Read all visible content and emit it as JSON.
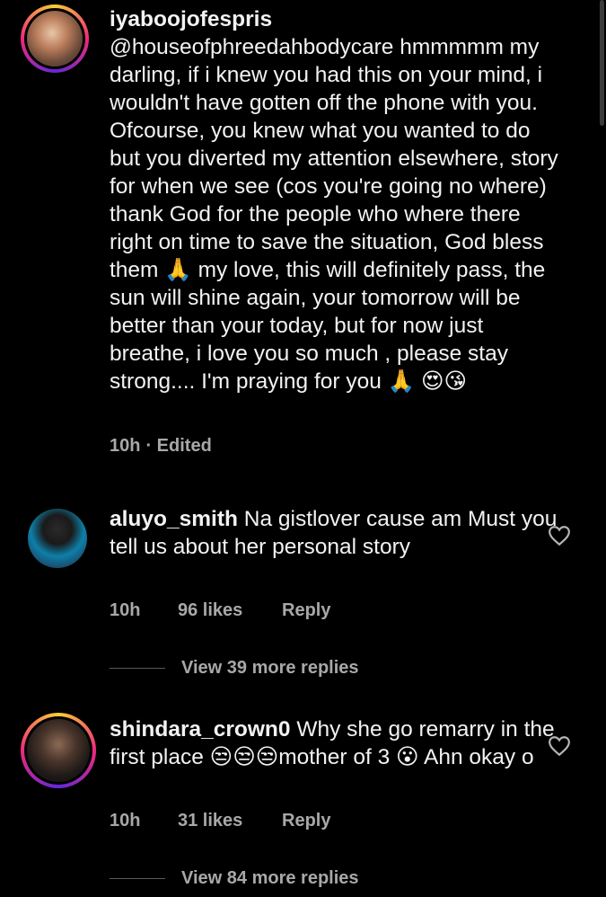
{
  "comments": [
    {
      "username": "iyaboojofespris",
      "text": "@houseofphreedahbodycare hmmmmm my darling, if i knew you had this on your mind, i wouldn't have gotten off the phone with you. Ofcourse, you knew what you wanted to do but you diverted my attention elsewhere, story for when we see (cos you're going no where) thank God for the people who where there right on time to save the situation, God bless them 🙏 my love, this will definitely pass, the sun will shine again, your tomorrow will be better than your today, but for now just breathe, i love you so much , please stay strong.... I'm praying for you 🙏 😍😘",
      "time": "10h",
      "edited": "· Edited",
      "avatar_icon": "user-avatar"
    },
    {
      "username": "aluyo_smith",
      "text": "Na gistlover cause am Must you tell us about her personal story",
      "time": "10h",
      "likes": "96 likes",
      "reply": "Reply",
      "view_replies": "View 39 more replies",
      "avatar_icon": "user-avatar"
    },
    {
      "username": "shindara_crown0",
      "text": "Why she go remarry in the first place 😒😒😒mother of 3 😮 Ahn okay o",
      "time": "10h",
      "likes": "31 likes",
      "reply": "Reply",
      "view_replies": "View 84 more replies",
      "avatar_icon": "user-avatar"
    }
  ],
  "colors": {
    "background": "#000000",
    "text": "#f2f2f2",
    "muted": "#a8a8a8"
  }
}
